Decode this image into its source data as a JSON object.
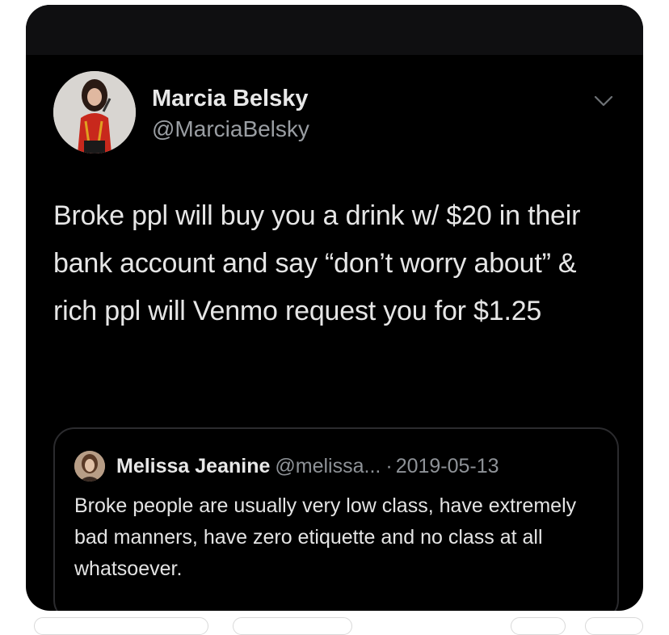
{
  "tweet": {
    "author_name": "Marcia Belsky",
    "author_handle": "@MarciaBelsky",
    "text": "Broke ppl will buy you a drink w/ $20 in their bank account and say “don’t worry about” & rich ppl will Venmo request you for $1.25"
  },
  "quoted_tweet": {
    "author_name": "Melissa Jeanine",
    "author_handle": "@melissa...",
    "separator": "·",
    "date": "2019-05-13",
    "text": "Broke people are usually very low class, have extremely bad manners, have zero etiquette and no class at all whatsoever."
  },
  "icons": {
    "menu": "chevron-down-icon"
  },
  "colors": {
    "card_background": "#000000",
    "primary_text": "#e6e6e6",
    "secondary_text": "#9a9ea3",
    "quote_border": "#2b2b2e"
  }
}
